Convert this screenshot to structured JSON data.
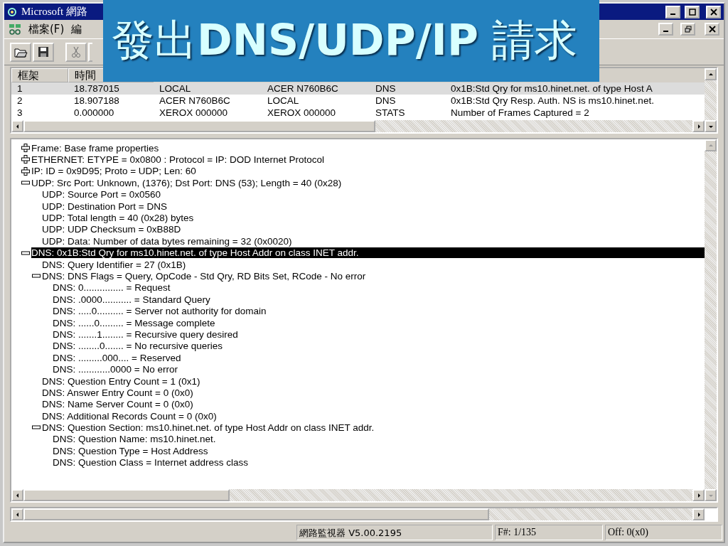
{
  "slide_title": "發出**DNS/UDP/IP** 請求",
  "window": {
    "title": "Microsoft 網路"
  },
  "menu": [
    {
      "label": "檔案(F)"
    },
    {
      "label": "編"
    }
  ],
  "frame_list": {
    "columns": [
      "框架",
      "時間"
    ],
    "rows": [
      {
        "selected": true,
        "cells": [
          "1",
          "18.787015",
          "LOCAL",
          "ACER N760B6C",
          "DNS",
          "0x1B:Std Qry for ms10.hinet.net. of type Host A"
        ]
      },
      {
        "selected": false,
        "cells": [
          "2",
          "18.907188",
          "ACER N760B6C",
          "LOCAL",
          "DNS",
          "0x1B:Std Qry Resp. Auth. NS is ms10.hinet.net."
        ]
      },
      {
        "selected": false,
        "cells": [
          "3",
          "0.000000",
          "XEROX 000000",
          "XEROX 000000",
          "STATS",
          "Number of Frames Captured = 2"
        ]
      }
    ]
  },
  "details": [
    {
      "expanded": false,
      "selected": false,
      "label": "Frame: Base frame properties"
    },
    {
      "expanded": false,
      "selected": false,
      "label": "ETHERNET: ETYPE = 0x0800 : Protocol = IP:  DOD Internet Protocol"
    },
    {
      "expanded": false,
      "selected": false,
      "label": "IP: ID = 0x9D95; Proto = UDP; Len: 60"
    },
    {
      "expanded": true,
      "selected": false,
      "label": "UDP: Src Port: Unknown, (1376); Dst Port: DNS (53); Length = 40 (0x28)",
      "children": [
        {
          "selected": false,
          "label": "UDP: Source Port = 0x0560"
        },
        {
          "selected": false,
          "label": "UDP: Destination Port = DNS"
        },
        {
          "selected": false,
          "label": "UDP: Total length = 40 (0x28) bytes"
        },
        {
          "selected": false,
          "label": "UDP: UDP Checksum = 0xB88D"
        },
        {
          "selected": false,
          "label": "UDP: Data: Number of data bytes remaining = 32 (0x0020)"
        }
      ]
    },
    {
      "expanded": true,
      "selected": true,
      "label": "DNS: 0x1B:Std Qry for ms10.hinet.net. of type Host Addr on class INET addr.",
      "children": [
        {
          "selected": false,
          "label": "DNS: Query Identifier = 27 (0x1B)"
        },
        {
          "expanded": true,
          "selected": false,
          "label": "DNS: DNS Flags = Query, OpCode - Std Qry, RD Bits Set, RCode - No error",
          "children": [
            {
              "selected": false,
              "label": "DNS: 0............... = Request"
            },
            {
              "selected": false,
              "label": "DNS: .0000........... = Standard Query"
            },
            {
              "selected": false,
              "label": "DNS: .....0.......... = Server not authority for domain"
            },
            {
              "selected": false,
              "label": "DNS: ......0......... = Message complete"
            },
            {
              "selected": false,
              "label": "DNS: .......1........ = Recursive query desired"
            },
            {
              "selected": false,
              "label": "DNS: ........0....... = No recursive queries"
            },
            {
              "selected": false,
              "label": "DNS: .........000.... = Reserved"
            },
            {
              "selected": false,
              "label": "DNS: ............0000 = No error"
            }
          ]
        },
        {
          "selected": false,
          "label": "DNS: Question Entry Count = 1 (0x1)"
        },
        {
          "selected": false,
          "label": "DNS: Answer Entry Count = 0 (0x0)"
        },
        {
          "selected": false,
          "label": "DNS: Name Server Count = 0 (0x0)"
        },
        {
          "selected": false,
          "label": "DNS: Additional Records Count = 0 (0x0)"
        },
        {
          "expanded": true,
          "selected": false,
          "label": "DNS: Question Section: ms10.hinet.net. of type Host Addr on class INET addr.",
          "children": [
            {
              "selected": false,
              "label": "DNS: Question Name: ms10.hinet.net."
            },
            {
              "selected": false,
              "label": "DNS: Question Type = Host Address"
            },
            {
              "selected": false,
              "label": "DNS: Question Class = Internet address class"
            }
          ]
        }
      ]
    }
  ],
  "status_bar": [
    "網路監視器 V5.00.2195",
    "F#: 1/135",
    "Off: 0(x0)"
  ]
}
